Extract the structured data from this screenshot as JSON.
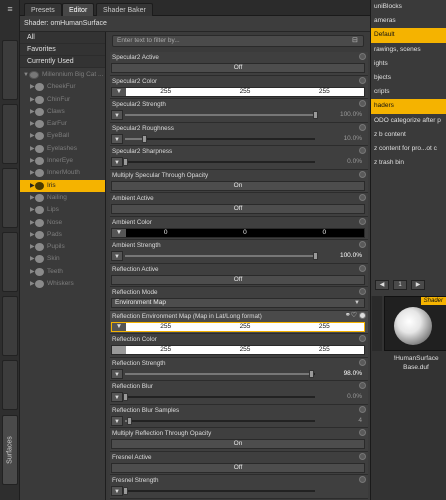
{
  "side_tab": {
    "label": "Surfaces"
  },
  "top_tabs": [
    "Presets",
    "Editor",
    "Shader Baker"
  ],
  "shader_title": "Shader: omHumanSurface",
  "categories": [
    "All",
    "Favorites",
    "Currently Used"
  ],
  "tree": {
    "root": "Millennium Big Cat ...",
    "items": [
      "CheekFur",
      "ChinFur",
      "Claws",
      "EarFur",
      "EyeBall",
      "Eyelashes",
      "InnerEye",
      "InnerMouth",
      "Iris",
      "Nailing",
      "Lips",
      "Nose",
      "Pads",
      "Pupils",
      "Skin",
      "Teeth",
      "Whiskers"
    ],
    "selected": "Iris"
  },
  "filter": {
    "placeholder": "Enter text to filter by..."
  },
  "properties": [
    {
      "label": "Specular2 Active",
      "kind": "toggle",
      "value": "Off"
    },
    {
      "label": "Specular2 Color",
      "kind": "color",
      "style": "white",
      "values": [
        "255",
        "255",
        "255"
      ]
    },
    {
      "label": "Specular2 Strength",
      "kind": "slider",
      "value": "100.0%",
      "fill": 1.0
    },
    {
      "label": "Specular2 Roughness",
      "kind": "slider",
      "value": "10.0%",
      "fill": 0.1
    },
    {
      "label": "Specular2 Sharpness",
      "kind": "slider",
      "value": "0.0%",
      "fill": 0.0
    },
    {
      "label": "Multiply Specular Through Opacity",
      "kind": "toggle",
      "value": "On"
    },
    {
      "label": "Ambient Active",
      "kind": "toggle",
      "value": "Off"
    },
    {
      "label": "Ambient Color",
      "kind": "color",
      "style": "black",
      "values": [
        "0",
        "0",
        "0"
      ]
    },
    {
      "label": "Ambient Strength",
      "kind": "slider",
      "value": "100.0%",
      "fill": 1.0,
      "on": true
    },
    {
      "label": "Reflection Active",
      "kind": "toggle",
      "value": "Off"
    },
    {
      "label": "Reflection Mode",
      "kind": "dropdown",
      "value": "Environment Map"
    },
    {
      "label": "Reflection Environment Map (Map in Lat/Long format)",
      "kind": "color",
      "style": "mapbox",
      "values": [
        "255",
        "255",
        "255"
      ],
      "highlight": true
    },
    {
      "label": "Reflection Color",
      "kind": "color",
      "style": "white",
      "values": [
        "255",
        "255",
        "255"
      ],
      "thumb": true
    },
    {
      "label": "Reflection Strength",
      "kind": "slider",
      "value": "98.0%",
      "fill": 0.98,
      "on": true
    },
    {
      "label": "Reflection Blur",
      "kind": "slider",
      "value": "0.0%",
      "fill": 0.0
    },
    {
      "label": "Reflection Blur Samples",
      "kind": "slider",
      "value": "4",
      "fill": 0.02
    },
    {
      "label": "Multiply Reflection Through Opacity",
      "kind": "toggle",
      "value": "On"
    },
    {
      "label": "Fresnel Active",
      "kind": "toggle",
      "value": "Off"
    },
    {
      "label": "Fresnel Strength",
      "kind": "slider",
      "value": "",
      "fill": 0.0
    }
  ],
  "right_list": [
    {
      "label": "uniBlocks",
      "selected": false
    },
    {
      "label": "ameras",
      "selected": false
    },
    {
      "label": "Default",
      "selected": true
    },
    {
      "label": "rawings, scenes",
      "selected": false
    },
    {
      "label": "ights",
      "selected": false
    },
    {
      "label": "bjects",
      "selected": false
    },
    {
      "label": "cripts",
      "selected": false
    },
    {
      "label": "haders",
      "selected": true
    },
    {
      "label": "ODO categorize after p",
      "selected": false
    },
    {
      "label": "z b content",
      "selected": false
    },
    {
      "label": "z content for pro...ot c",
      "selected": false
    },
    {
      "label": "z trash bin",
      "selected": false
    }
  ],
  "right_nav": {
    "left": "◀",
    "page": "1",
    "right": "▶"
  },
  "preview": {
    "badge": "Shader",
    "caption_line1": "!HumanSurface",
    "caption_line2": "Base.duf"
  },
  "colors": {
    "accent": "#f5b300",
    "panel": "#3b3b3b"
  }
}
